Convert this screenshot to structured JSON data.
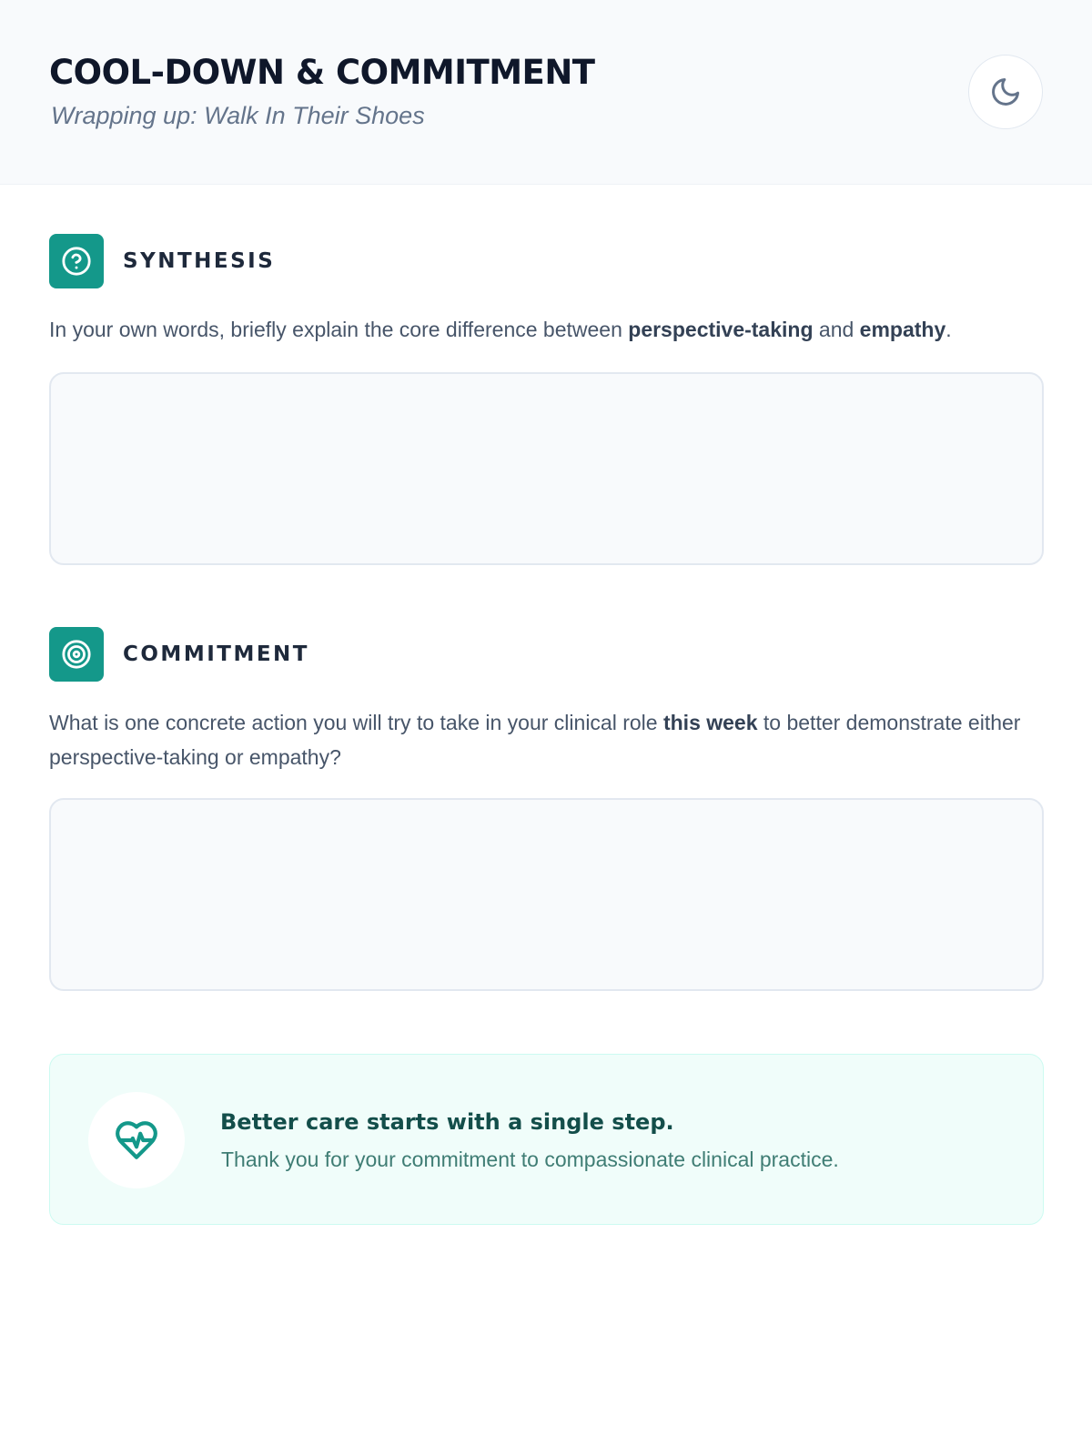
{
  "header": {
    "title": "COOL-DOWN & COMMITMENT",
    "subtitle": "Wrapping up: Walk In Their Shoes",
    "theme_toggle_icon": "moon-icon"
  },
  "synthesis": {
    "label": "SYNTHESIS",
    "icon": "question-circle-icon",
    "prompt": {
      "part1": "In your own words, briefly explain the core difference between ",
      "bold1": "perspective-taking",
      "part2": " and ",
      "bold2": "empathy",
      "part3": "."
    },
    "answer_value": ""
  },
  "commitment": {
    "label": "COMMITMENT",
    "icon": "target-icon",
    "prompt": {
      "part1": "What is one concrete action you will try to take in your clinical role ",
      "bold1": "this week",
      "part2": " to better demonstrate either perspective-taking or empathy?"
    },
    "answer_value": ""
  },
  "callout": {
    "icon": "heart-pulse-icon",
    "title": "Better care starts with a single step.",
    "text": "Thank you for your commitment to compassionate clinical practice."
  },
  "colors": {
    "accent": "#14988a",
    "header_bg": "#f8fafc",
    "callout_bg": "#f0fdfa",
    "callout_title": "#134e4a"
  }
}
